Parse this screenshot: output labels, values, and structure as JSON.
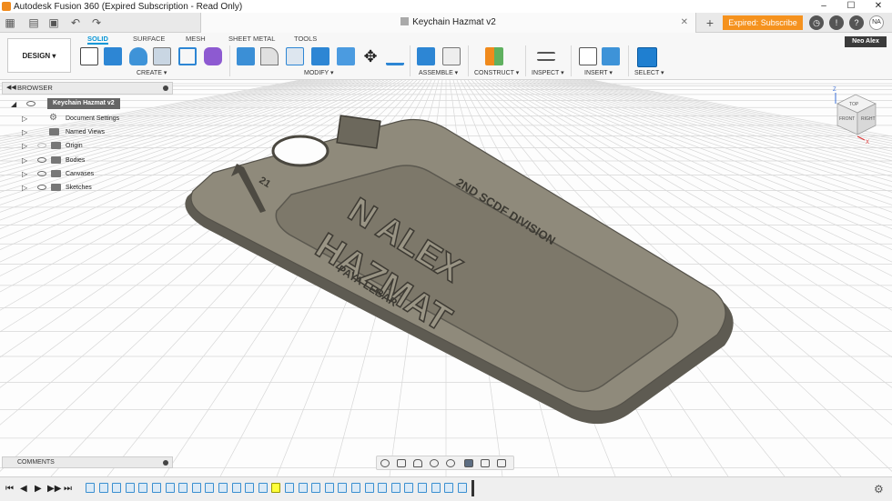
{
  "window": {
    "title": "Autodesk Fusion 360 (Expired Subscription - Read Only)",
    "controls": [
      "–",
      "☐",
      "✕"
    ]
  },
  "tabbar": {
    "doc_title": "Keychain Hazmat v2",
    "close": "✕",
    "add": "+",
    "subscribe_label": "Expired: Subscribe Now",
    "user_initials": "NA",
    "icons": [
      "apps-grid-icon",
      "save-icon",
      "undo-icon",
      "redo-icon",
      "clock-icon",
      "bell-icon",
      "help-icon"
    ]
  },
  "toolbar": {
    "workspace": "DESIGN ▾",
    "tabs": [
      "SOLID",
      "SURFACE",
      "MESH",
      "SHEET METAL",
      "TOOLS"
    ],
    "active_tab": "SOLID",
    "groups": [
      "CREATE ▾",
      "MODIFY ▾",
      "ASSEMBLE ▾",
      "CONSTRUCT ▾",
      "INSPECT ▾",
      "INSERT ▾",
      "SELECT ▾"
    ],
    "user_name": "Neo Alex"
  },
  "browser": {
    "header": "BROWSER",
    "root": "Keychain Hazmat v2",
    "items": [
      {
        "label": "Document Settings",
        "icon": "gear-icon"
      },
      {
        "label": "Named Views",
        "icon": "folder-icon"
      },
      {
        "label": "Origin",
        "icon": "folder-icon"
      },
      {
        "label": "Bodies",
        "icon": "folder-icon"
      },
      {
        "label": "Canvases",
        "icon": "folder-icon"
      },
      {
        "label": "Sketches",
        "icon": "folder-icon"
      }
    ]
  },
  "model": {
    "top_text": "2ND SCDF DIVISION",
    "name_line_1": "N ALEX",
    "name_line_2": "HAZMAT",
    "number": "21",
    "bottom_text": "PAYA LEBAR"
  },
  "viewcube": {
    "top": "TOP",
    "front": "FRONT",
    "right": "RIGHT",
    "axis_z": "Z",
    "axis_x": "X"
  },
  "comments": {
    "header": "COMMENTS"
  },
  "timeline": {
    "controls": [
      "⏮",
      "◀",
      "▶",
      "▶▶",
      "⏭"
    ],
    "item_count": 29,
    "highlighted_index": 14
  }
}
